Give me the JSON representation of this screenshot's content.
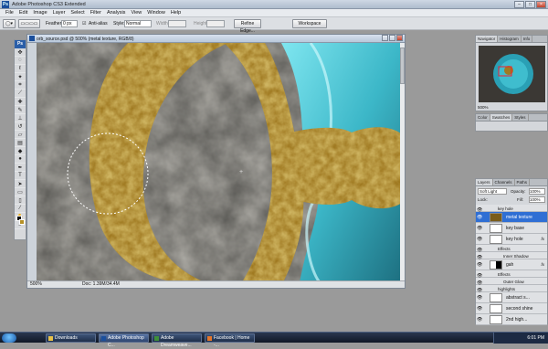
{
  "app": {
    "window_title": "Adobe Photoshop CS3 Extended",
    "logo": "Ps"
  },
  "menu": [
    "File",
    "Edit",
    "Image",
    "Layer",
    "Select",
    "Filter",
    "Analysis",
    "View",
    "Window",
    "Help"
  ],
  "options_bar": {
    "feather_label": "Feather:",
    "feather_value": "0 px",
    "antialias_label": "Anti-alias",
    "style_label": "Style:",
    "style_value": "Normal",
    "width_label": "Width:",
    "height_label": "Height:",
    "refine_edge_button": "Refine Edge...",
    "workspace_button": "Workspace"
  },
  "document": {
    "title": "orb_source.psd @ 500% (metal texture, RGB/8)",
    "zoom": "500%",
    "doc_size": "Doc: 1.39M/34.4M"
  },
  "navigator": {
    "tabs": [
      "Navigator",
      "Histogram",
      "Info"
    ],
    "zoom": "500%"
  },
  "color_panel": {
    "tabs": [
      "Color",
      "Swatches",
      "Styles"
    ]
  },
  "layers_panel": {
    "tabs": [
      "Layers",
      "Channels",
      "Paths"
    ],
    "blend_mode": "Soft Light",
    "opacity_label": "Opacity:",
    "opacity_value": "100%",
    "lock_label": "Lock:",
    "fill_label": "Fill:",
    "fill_value": "100%",
    "layers": [
      {
        "name": "key hole",
        "kind": "group"
      },
      {
        "name": "metal texture",
        "kind": "layer",
        "selected": true
      },
      {
        "name": "key base",
        "kind": "layer"
      },
      {
        "name": "key hole",
        "kind": "layer",
        "fx": "fx"
      },
      {
        "name": "Effects",
        "kind": "effect"
      },
      {
        "name": "Inner Shadow",
        "kind": "effect"
      },
      {
        "name": "gah",
        "kind": "layer",
        "fx": "fx"
      },
      {
        "name": "Effects",
        "kind": "effect"
      },
      {
        "name": "Outer Glow",
        "kind": "effect"
      },
      {
        "name": "highlights",
        "kind": "group"
      },
      {
        "name": "abstract s...",
        "kind": "layer"
      },
      {
        "name": "second shine",
        "kind": "layer"
      },
      {
        "name": "2nd high...",
        "kind": "layer"
      }
    ]
  },
  "taskbar": {
    "items": [
      "Downloads",
      "Adobe Photoshop C...",
      "Adobe Dreamweave...",
      "Facebook | Home -..."
    ],
    "time": "6:01 PM"
  },
  "colors": {
    "stone": "#5e5d59",
    "gold": "#a07a22",
    "orb_blue": "#3fc3d3",
    "selection": "#2f6fd4",
    "foreground": "#000000",
    "background": "#b69127"
  }
}
